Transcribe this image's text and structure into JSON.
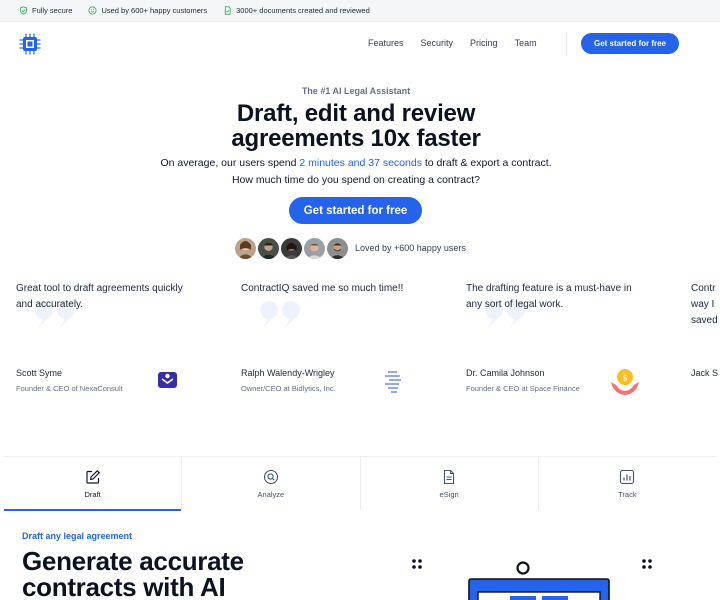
{
  "topbar": {
    "items": [
      {
        "icon": "shield-check-icon",
        "label": "Fully secure"
      },
      {
        "icon": "smile-icon",
        "label": "Used by 600+ happy customers"
      },
      {
        "icon": "document-check-icon",
        "label": "3000+ documents created and reviewed"
      }
    ]
  },
  "nav": {
    "logo": "chip-logo-icon",
    "links": [
      "Features",
      "Security",
      "Pricing",
      "Team"
    ],
    "cta": "Get started for free"
  },
  "hero": {
    "eyebrow": "The #1 AI Legal Assistant",
    "title_line1": "Draft, edit and review",
    "title_line2": "agreements 10x faster",
    "sub_before": "On average, our users spend ",
    "sub_highlight": "2 minutes and 37 seconds",
    "sub_after": " to draft & export a contract. How much time do you spend on creating a contract?",
    "cta": "Get started for free",
    "loved": "Loved by +600 happy users"
  },
  "testimonials": [
    {
      "quote": "Great tool to draft agreements quickly and accurately.",
      "name": "Scott Syme",
      "role": "Founder & CEO of NexaConsult",
      "logo": "nexaconsult-logo"
    },
    {
      "quote": "ContractIQ saved me so much time!!",
      "name": "Ralph Walendy-Wrigley",
      "role": "Owner/CEO at Bidlytics, Inc.",
      "logo": "bidlytics-logo"
    },
    {
      "quote": "The drafting feature is a must-have in any sort of legal work.",
      "name": "Dr. Camila Johnson",
      "role": "Founder & CEO at Space Finance",
      "logo": "space-finance-logo"
    },
    {
      "quote": "Contr way I saved",
      "name": "Jack S",
      "role": "",
      "logo": ""
    }
  ],
  "tabs": [
    {
      "label": "Draft",
      "icon": "edit-icon",
      "active": true
    },
    {
      "label": "Analyze",
      "icon": "search-icon",
      "active": false
    },
    {
      "label": "eSign",
      "icon": "document-icon",
      "active": false
    },
    {
      "label": "Track",
      "icon": "bar-chart-icon",
      "active": false
    }
  ],
  "section": {
    "eyebrow": "Draft any legal agreement",
    "title_line1": "Generate accurate",
    "title_line2": "contracts with AI"
  },
  "colors": {
    "accent": "#2563eb",
    "text": "#0b1220",
    "muted": "#667085"
  }
}
